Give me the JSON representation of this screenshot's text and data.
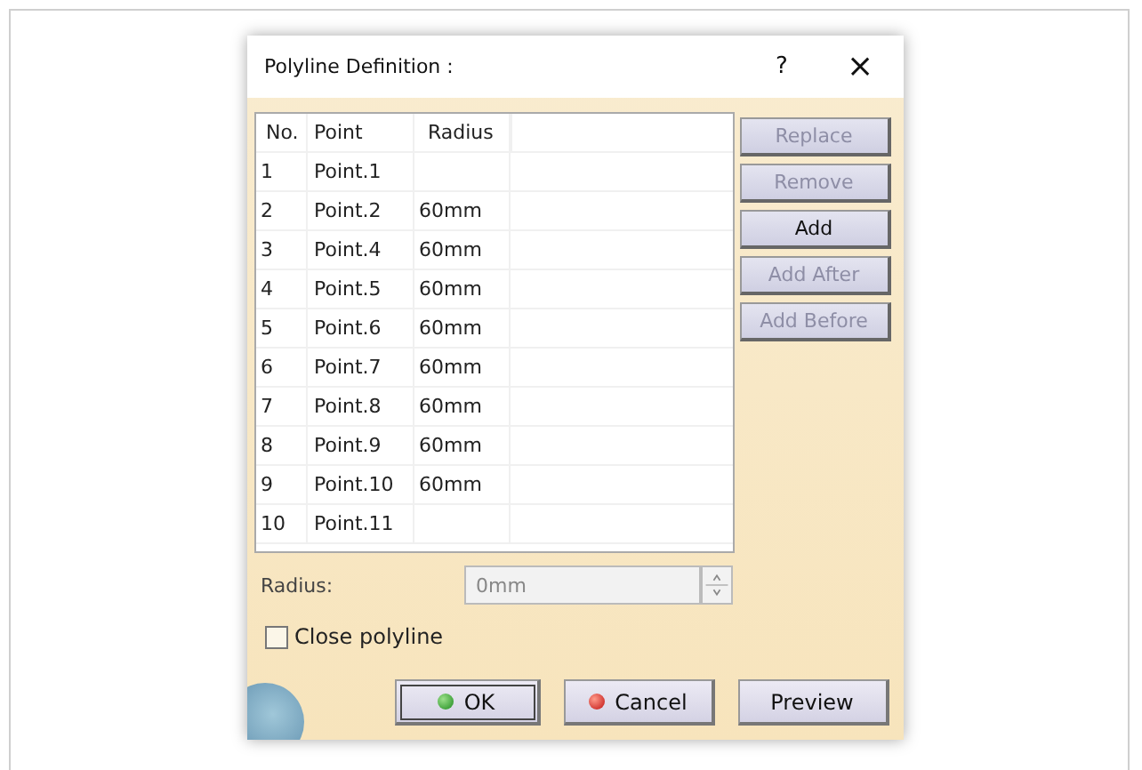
{
  "window": {
    "title": "Polyline Definition :",
    "help": "?",
    "close": "×"
  },
  "table": {
    "columns": [
      "No.",
      "Point",
      "Radius"
    ],
    "rows": [
      [
        "1",
        "Point.1",
        ""
      ],
      [
        "2",
        "Point.2",
        "60mm"
      ],
      [
        "3",
        "Point.4",
        "60mm"
      ],
      [
        "4",
        "Point.5",
        "60mm"
      ],
      [
        "5",
        "Point.6",
        "60mm"
      ],
      [
        "6",
        "Point.7",
        "60mm"
      ],
      [
        "7",
        "Point.8",
        "60mm"
      ],
      [
        "8",
        "Point.9",
        "60mm"
      ],
      [
        "9",
        "Point.10",
        "60mm"
      ],
      [
        "10",
        "Point.11",
        ""
      ]
    ]
  },
  "side_buttons": [
    {
      "label": "Replace",
      "disabled": true
    },
    {
      "label": "Remove",
      "disabled": true
    },
    {
      "label": "Add",
      "disabled": false
    },
    {
      "label": "Add After",
      "disabled": true
    },
    {
      "label": "Add Before",
      "disabled": true
    }
  ],
  "radius": {
    "label": "Radius:",
    "value": "0mm",
    "disabled": true
  },
  "close_polyline": {
    "label": "Close polyline",
    "checked": false
  },
  "footer_buttons": [
    {
      "label": "OK",
      "kind": "ok",
      "default": true
    },
    {
      "label": "Cancel",
      "kind": "cancel",
      "default": false
    },
    {
      "label": "Preview",
      "kind": "plain",
      "default": false
    }
  ]
}
